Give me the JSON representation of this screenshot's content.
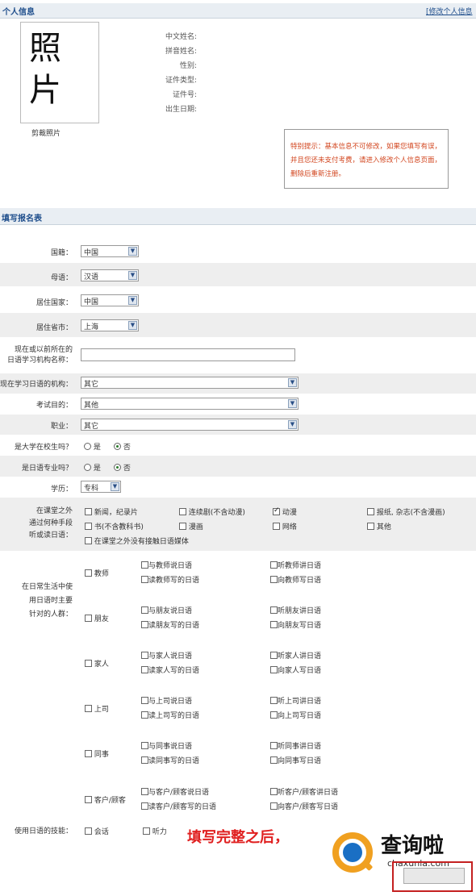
{
  "personal": {
    "title": "个人信息",
    "edit_link": "[修改个人信息",
    "photo_text": "照\n片",
    "crop_link": "剪裁照片",
    "fields": [
      {
        "label": "中文姓名:"
      },
      {
        "label": "拼音姓名:"
      },
      {
        "label": "性别:"
      },
      {
        "label": "证件类型:"
      },
      {
        "label": "证件号:"
      },
      {
        "label": "出生日期:"
      }
    ],
    "notice": "特别提示：基本信息不可修改，如果您填写有误，并且您还未支付考费，请进入修改个人信息页面，删除后重新注册。"
  },
  "form": {
    "title": "填写报名表",
    "nationality": {
      "label": "国籍：",
      "value": "中国"
    },
    "mother_tongue": {
      "label": "母语：",
      "value": "汉语"
    },
    "residence_country": {
      "label": "居住国家：",
      "value": "中国"
    },
    "residence_city": {
      "label": "居住省市：",
      "value": "上海"
    },
    "institution_name": {
      "label": "现在或以前所在的\n日语学习机构名称：",
      "value": ""
    },
    "institution": {
      "label": "现在学习日语的机构：",
      "value": "其它"
    },
    "purpose": {
      "label": "考试目的：",
      "value": "其他"
    },
    "occupation": {
      "label": "职业：",
      "value": "其它"
    },
    "university_student": {
      "label": "是大学在校生吗？",
      "yes": "是",
      "no": "否",
      "selected": "no"
    },
    "japanese_major": {
      "label": "是日语专业吗？",
      "yes": "是",
      "no": "否",
      "selected": "no"
    },
    "education": {
      "label": "学历：",
      "value": "专科"
    },
    "media": {
      "label": "在课堂之外\n通过何种手段\n听或读日语：",
      "options": [
        {
          "text": "新闻，纪录片",
          "checked": false
        },
        {
          "text": "连续剧(不含动漫)",
          "checked": false
        },
        {
          "text": "动漫",
          "checked": true
        },
        {
          "text": "报纸, 杂志(不含漫画)",
          "checked": false
        },
        {
          "text": "书(不含教科书)",
          "checked": false
        },
        {
          "text": "漫画",
          "checked": false
        },
        {
          "text": "网络",
          "checked": false
        },
        {
          "text": "其他",
          "checked": false
        },
        {
          "text": "在课堂之外没有接触日语媒体",
          "checked": false
        }
      ]
    },
    "targets": {
      "label": "在日常生活中使\n用日语时主要\n针对的人群：",
      "groups": [
        {
          "name": "教师",
          "opts": [
            "与教师说日语",
            "听教师讲日语",
            "读教师写的日语",
            "向教师写日语"
          ]
        },
        {
          "name": "朋友",
          "opts": [
            "与朋友说日语",
            "听朋友讲日语",
            "读朋友写的日语",
            "向朋友写日语"
          ]
        },
        {
          "name": "家人",
          "opts": [
            "与家人说日语",
            "听家人讲日语",
            "读家人写的日语",
            "向家人写日语"
          ]
        },
        {
          "name": "上司",
          "opts": [
            "与上司说日语",
            "听上司讲日语",
            "读上司写的日语",
            "向上司写日语"
          ]
        },
        {
          "name": "同事",
          "opts": [
            "与同事说日语",
            "听同事讲日语",
            "读同事写的日语",
            "向同事写日语"
          ]
        },
        {
          "name": "客户/顾客",
          "opts": [
            "与客户/顾客说日语",
            "听客户/顾客讲日语",
            "读客户/顾客写的日语",
            "向客户/顾客写日语"
          ]
        }
      ]
    },
    "skills": {
      "label": "使用日语的技能：",
      "options": [
        "会话",
        "听力"
      ]
    }
  },
  "overlay": {
    "caption": "填写完整之后，",
    "logo_main": "查询啦",
    "logo_sub": "chaxunla.com",
    "accent": "#e02020",
    "logo_blue": "#1a6fc4",
    "logo_orange": "#f0a020"
  }
}
